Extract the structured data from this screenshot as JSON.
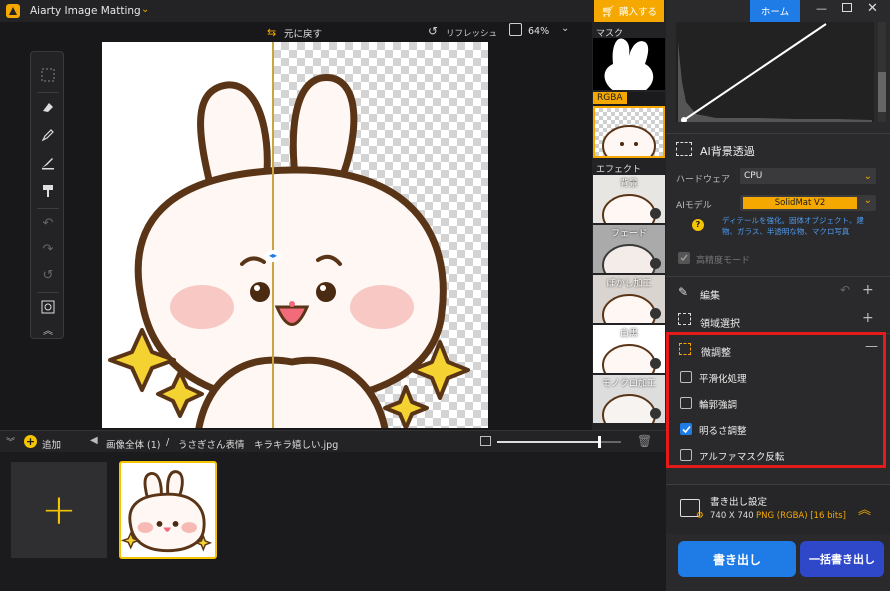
{
  "app": {
    "title": "Aiarty Image Matting",
    "buy_label": "購入する",
    "home_label": "ホーム"
  },
  "topbar": {
    "undo_label": "元に戻す",
    "refresh_label": "リフレッシュ",
    "zoom": "64%"
  },
  "thumbs": {
    "mask_label": "マスク",
    "rgba_label": "RGBA",
    "effect_label": "エフェクト",
    "effects": [
      "背景",
      "フェード",
      "ぼかし加工",
      "白黒",
      "モノクロ加工"
    ]
  },
  "sidebar": {
    "bg_section_title": "AI背景透過",
    "hardware_label": "ハードウェア",
    "hardware_value": "CPU",
    "model_label": "AIモデル",
    "model_value": "SolidMat  V2",
    "model_desc": "ディテールを強化。固体オブジェクト、建物、ガラス、半透明な物、マクロ写真",
    "hq_mode_label": "高精度モード",
    "edit_label": "編集",
    "region_label": "領域選択",
    "fine_label": "微調整",
    "options": [
      {
        "label": "平滑化処理",
        "checked": false
      },
      {
        "label": "輪郭強調",
        "checked": false
      },
      {
        "label": "明るさ調整",
        "checked": true
      },
      {
        "label": "アルファマスク反転",
        "checked": false
      }
    ],
    "export_title": "書き出し設定",
    "export_size": "740 X 740",
    "export_format": "PNG (RGBA) [16 bits]",
    "export_btn": "書き出し",
    "batch_btn": "一括書き出し"
  },
  "filebar": {
    "add_label": "追加",
    "crumb_all": "画像全体 (1)",
    "crumb_sep": "/",
    "filename": "うさぎさん表情　キラキラ嬉しい.jpg",
    "slider_fraction": 0.82
  },
  "colors": {
    "accent": "#f5a900",
    "highlight": "#e51a1a",
    "blue": "#1f7be6"
  }
}
